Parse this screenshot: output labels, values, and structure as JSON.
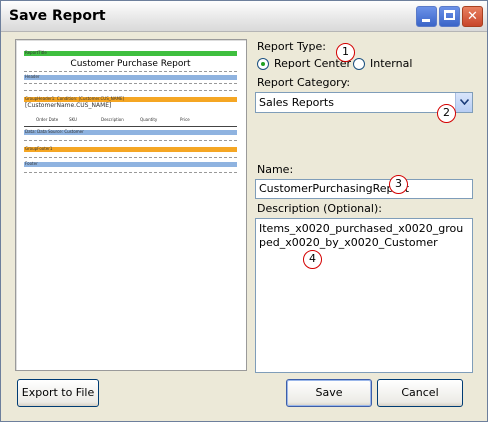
{
  "window": {
    "title": "Save Report"
  },
  "preview": {
    "report_title_band": "ReportTitle",
    "report_title": "Customer Purchase Report",
    "header_band": "Header",
    "group_header_band": "GroupHeader1: Condition: [Customer.CUS_NAME]",
    "group_field": "[CustomerName.CUS_NAME]",
    "columns": [
      "Order Date",
      "SKU",
      "Description",
      "Quantity",
      "Price"
    ],
    "detail_band": "Data: Data Source: Customer",
    "group_footer_band": "GroupFooter1",
    "footer_band": "Footer"
  },
  "report_type": {
    "label": "Report Type:",
    "options": [
      "Report Center",
      "Internal"
    ],
    "selected": "Report Center"
  },
  "report_category": {
    "label": "Report Category:",
    "value": "Sales Reports"
  },
  "name": {
    "label": "Name:",
    "value": "CustomerPurchasingReport"
  },
  "description": {
    "label": "Description (Optional):",
    "value": "Items_x0020_purchased_x0020_grouped_x0020_by_x0020_Customer"
  },
  "buttons": {
    "export": "Export to File",
    "save": "Save",
    "cancel": "Cancel"
  },
  "markers": [
    "1",
    "2",
    "3",
    "4"
  ],
  "colors": {
    "radio_selected": "#21a121",
    "marker_border": "#d40000",
    "band_green": "#3fbf3f",
    "band_blue": "#8fb3e0",
    "band_orange": "#f5a623"
  }
}
